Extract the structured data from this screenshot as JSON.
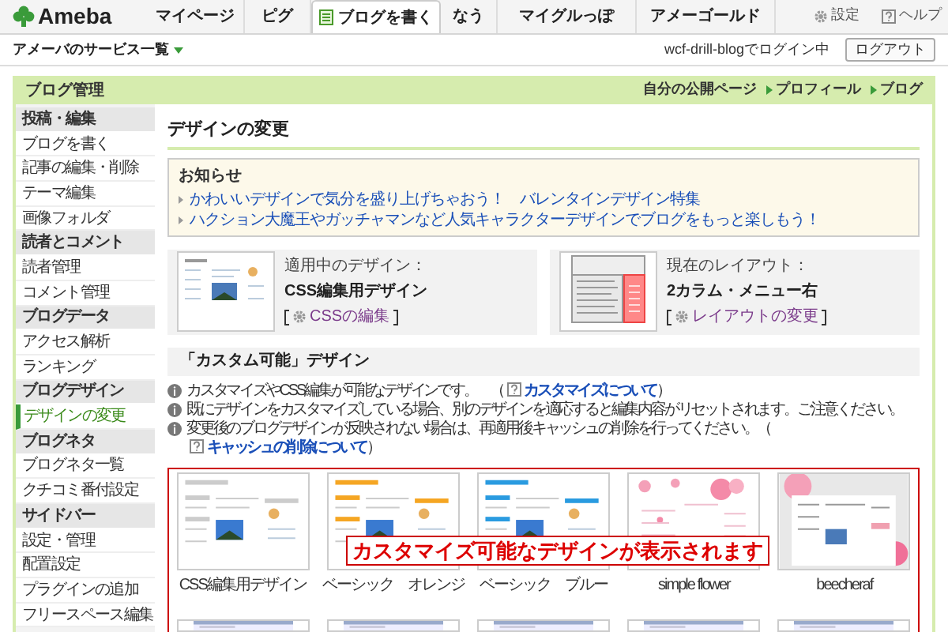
{
  "header": {
    "logo": "Ameba",
    "tabs": [
      {
        "label": "マイページ",
        "selected": false
      },
      {
        "label": "ピグ",
        "selected": false
      },
      {
        "label": "ブログを書く",
        "selected": true
      },
      {
        "label": "なう",
        "selected": false
      },
      {
        "label": "マイグルっぽ",
        "selected": false
      },
      {
        "label": "アメーゴールド",
        "selected": false
      }
    ],
    "settings": "設定",
    "help": "ヘルプ"
  },
  "subbar": {
    "services": "アメーバのサービス一覧",
    "login": "wcf-drill-blogでログイン中",
    "logout": "ログアウト"
  },
  "panel": {
    "title": "ブログ管理",
    "links": [
      "自分の公開ページ",
      "プロフィール",
      "ブログ"
    ]
  },
  "sidebar": [
    {
      "heading": "投稿・編集",
      "items": [
        {
          "label": "ブログを書く",
          "selected": false
        },
        {
          "label": "記事の編集・削除",
          "selected": false
        },
        {
          "label": "テーマ編集",
          "selected": false
        },
        {
          "label": "画像フォルダ",
          "selected": false
        }
      ]
    },
    {
      "heading": "読者とコメント",
      "items": [
        {
          "label": "読者管理",
          "selected": false
        },
        {
          "label": "コメント管理",
          "selected": false
        }
      ]
    },
    {
      "heading": "ブログデータ",
      "items": [
        {
          "label": "アクセス解析",
          "selected": false
        },
        {
          "label": "ランキング",
          "selected": false
        }
      ]
    },
    {
      "heading": "ブログデザイン",
      "items": [
        {
          "label": "デザインの変更",
          "selected": true
        }
      ]
    },
    {
      "heading": "ブログネタ",
      "items": [
        {
          "label": "ブログネタ一覧",
          "selected": false
        },
        {
          "label": "クチコミ番付設定",
          "selected": false
        }
      ]
    },
    {
      "heading": "サイドバー",
      "items": [
        {
          "label": "設定・管理",
          "selected": false
        },
        {
          "label": "配置設定",
          "selected": false
        },
        {
          "label": "プラグインの追加",
          "selected": false
        },
        {
          "label": "フリースペース編集",
          "selected": false
        }
      ]
    }
  ],
  "content": {
    "title": "デザインの変更",
    "notice": {
      "title": "お知らせ",
      "links": [
        "かわいいデザインで気分を盛り上げちゃおう！　バレンタインデザイン特集",
        "ハクション大魔王やガッチャマンなど人気キャラクターデザインでブログをもっと楽しもう！"
      ]
    },
    "current": [
      {
        "kind": "design",
        "label": "適用中のデザイン：",
        "name": "CSS編集用デザイン",
        "action": "CSSの編集"
      },
      {
        "kind": "layout",
        "label": "現在のレイアウト：",
        "name": "2カラム・メニュー右",
        "action": "レイアウトの変更"
      }
    ],
    "custom": {
      "title": "「カスタム可能」デザイン",
      "notes": [
        {
          "text": "カスタマイズやCSS編集が可能なデザインです。　（",
          "link": "カスタマイズについて",
          "after": "）"
        },
        {
          "text": "既にデザインをカスタマイズしている場合、別のデザインを適応すると編集内容がリセットされます。ご注意ください。"
        },
        {
          "text": "変更後のブログデザインが反映されない場合は、再適用後キャッシュの削除を行ってください。（",
          "link": "キャッシュの削除について",
          "after": "）"
        }
      ],
      "designs": [
        {
          "name": "CSS編集用デザイン",
          "kind": "plain"
        },
        {
          "name": "ベーシック　オレンジ",
          "kind": "orange"
        },
        {
          "name": "ベーシック　ブルー",
          "kind": "blue"
        },
        {
          "name": "simple flower",
          "kind": "flower"
        },
        {
          "name": "beecheraf",
          "kind": "pink"
        }
      ],
      "annotation": "カスタマイズ可能なデザインが表示されます"
    }
  }
}
